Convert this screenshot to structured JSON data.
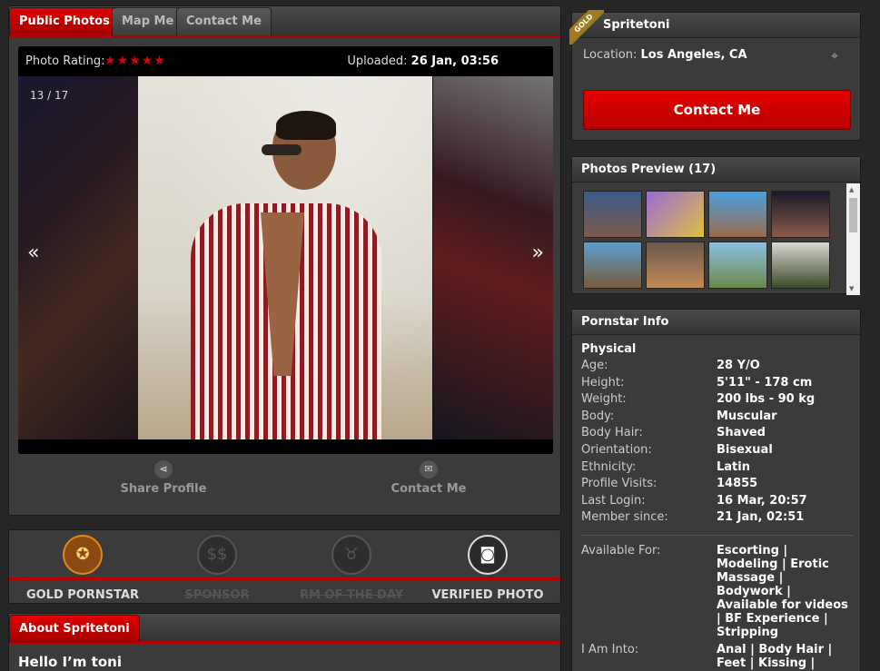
{
  "tabs": [
    "Public Photos",
    "Map Me",
    "Contact Me"
  ],
  "viewer": {
    "rating_label": "Photo Rating:",
    "stars": "★★★★★",
    "uploaded_label": "Uploaded:",
    "uploaded_value": "26 Jan, 03:56",
    "counter": "13 / 17",
    "prev": "«",
    "next": "»"
  },
  "actions": {
    "share": "Share Profile",
    "contact": "Contact Me"
  },
  "badges": [
    {
      "label": "GOLD PORNSTAR",
      "icon": "medal-icon",
      "active": true
    },
    {
      "label": "SPONSOR",
      "icon": "dollar-icon",
      "active": false
    },
    {
      "label": "RM OF THE DAY",
      "icon": "bull-icon",
      "active": false
    },
    {
      "label": "VERIFIED PHOTO",
      "icon": "camera-icon",
      "active": true
    }
  ],
  "about": {
    "tab": "About Spritetoni",
    "hello": "Hello I’m toni"
  },
  "profile": {
    "ribbon": "GOLD",
    "name": "Spritetoni",
    "location_label": "Location:",
    "location": "Los Angeles, CA",
    "contact_button": "Contact Me"
  },
  "photos_preview": {
    "title": "Photos Preview (17)"
  },
  "info": {
    "title": "Pornstar Info",
    "section": "Physical",
    "rows": [
      {
        "k": "Age:",
        "v": "28 Y/O"
      },
      {
        "k": "Height:",
        "v": "5'11\" - 178 cm"
      },
      {
        "k": "Weight:",
        "v": "200 lbs - 90 kg"
      },
      {
        "k": "Body:",
        "v": "Muscular"
      },
      {
        "k": "Body Hair:",
        "v": "Shaved"
      },
      {
        "k": "Orientation:",
        "v": "Bisexual"
      },
      {
        "k": "Ethnicity:",
        "v": "Latin"
      },
      {
        "k": "Profile Visits:",
        "v": "14855"
      },
      {
        "k": "Last Login:",
        "v": "16 Mar, 20:57"
      },
      {
        "k": "Member since:",
        "v": "21 Jan, 02:51"
      }
    ],
    "available_label": "Available For:",
    "available_value": "Escorting | Modeling | Erotic Massage | Bodywork | Available for videos | BF Experience | Stripping",
    "into_label": "I Am Into:",
    "into_value": "Anal | Body Hair | Feet | Kissing | Latex | Cum | Nipples | Oral"
  },
  "colors": {
    "accent": "#c00000",
    "gold": "#a07a1e",
    "panel": "#3b3b3b",
    "background": "#262626"
  }
}
